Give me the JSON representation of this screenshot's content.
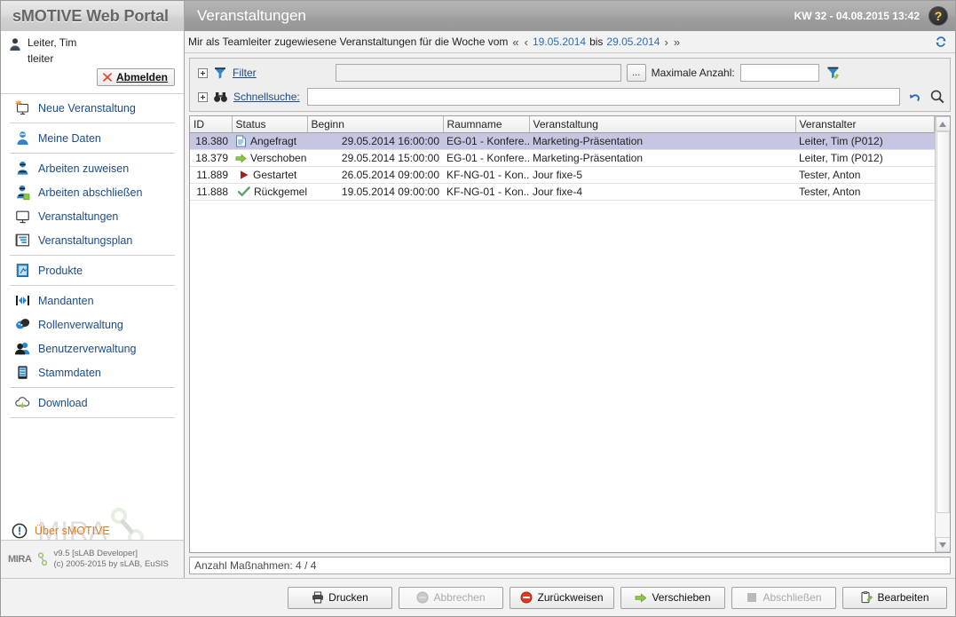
{
  "header": {
    "brand": "sMOTIVE Web Portal",
    "page_title": "Veranstaltungen",
    "datetime": "KW 32 - 04.08.2015 13:42",
    "help_label": "?",
    "help_icon": "question-mark-icon"
  },
  "sidebar": {
    "user": {
      "name": "Leiter, Tim",
      "login": "tleiter",
      "logout_label": "Abmelden",
      "logout_icon": "red-x-icon",
      "user_icon": "person-icon"
    },
    "groups": [
      {
        "items": [
          {
            "label": "Neue Veranstaltung",
            "icon": "new-presentation-icon"
          }
        ]
      },
      {
        "items": [
          {
            "label": "Meine Daten",
            "icon": "person-blue-icon"
          }
        ]
      },
      {
        "items": [
          {
            "label": "Arbeiten zuweisen",
            "icon": "assign-work-icon"
          },
          {
            "label": "Arbeiten abschließen",
            "icon": "complete-work-icon"
          },
          {
            "label": "Veranstaltungen",
            "icon": "monitor-icon"
          },
          {
            "label": "Veranstaltungsplan",
            "icon": "schedule-icon"
          }
        ]
      },
      {
        "items": [
          {
            "label": "Produkte",
            "icon": "product-book-icon"
          }
        ]
      },
      {
        "items": [
          {
            "label": "Mandanten",
            "icon": "clients-arrows-icon"
          },
          {
            "label": "Rollenverwaltung",
            "icon": "masks-roles-icon"
          },
          {
            "label": "Benutzerverwaltung",
            "icon": "users-icon"
          },
          {
            "label": "Stammdaten",
            "icon": "database-card-icon"
          }
        ]
      },
      {
        "items": [
          {
            "label": "Download",
            "icon": "cloud-download-icon"
          }
        ]
      }
    ],
    "watermark": "MIRA",
    "about": {
      "label": "Über sMOTIVE",
      "icon": "info-circle-icon"
    },
    "footer": {
      "logo": "MIRA",
      "line1": "v9.5 [sLAB Developer]",
      "line2": "(c) 2005-2015 by sLAB, EuSIS"
    }
  },
  "main": {
    "breadcrumb": {
      "prefix": "Mir als Teamleiter zugewiesene Veranstaltungen für die Woche vom",
      "first_icon": "double-chevron-left-icon",
      "prev_icon": "chevron-left-icon",
      "date_from": "19.05.2014",
      "between": "bis",
      "date_to": "29.05.2014",
      "next_icon": "chevron-right-icon",
      "last_icon": "double-chevron-right-icon",
      "refresh_icon": "refresh-icon"
    },
    "filter": {
      "filter_label": "Filter",
      "filter_icon": "funnel-icon",
      "filter_value": "",
      "filter_placeholder": "",
      "dots_label": "...",
      "max_count_label": "Maximale Anzahl:",
      "max_count_value": "",
      "apply_filter_icon": "funnel-apply-icon",
      "quicksearch_label": "Schnellsuche:",
      "quicksearch_icon": "binoculars-icon",
      "quicksearch_value": "",
      "reset_icon": "undo-arrow-icon",
      "search_icon": "magnifier-icon"
    },
    "table": {
      "columns": [
        "ID",
        "Status",
        "Beginn",
        "Raumname",
        "Veranstaltung",
        "Veranstalter"
      ],
      "rows": [
        {
          "id": "18.380",
          "status": "Angefragt",
          "status_icon": "document-requested-icon",
          "beginn": "29.05.2014 16:00:00",
          "raumname": "EG-01 - Konfere...",
          "veranstaltung": "Marketing-Präsentation",
          "veranstalter": "Leiter, Tim (P012)",
          "selected": true
        },
        {
          "id": "18.379",
          "status": "Verschoben",
          "status_icon": "green-arrow-right-icon",
          "beginn": "29.05.2014 15:00:00",
          "raumname": "EG-01 - Konfere...",
          "veranstaltung": "Marketing-Präsentation",
          "veranstalter": "Leiter, Tim (P012)",
          "selected": false
        },
        {
          "id": "11.889",
          "status": "Gestartet",
          "status_icon": "red-play-triangle-icon",
          "beginn": "26.05.2014 09:00:00",
          "raumname": "KF-NG-01 - Kon...",
          "veranstaltung": "Jour fixe-5",
          "veranstalter": "Tester, Anton",
          "selected": false
        },
        {
          "id": "11.888",
          "status": "Rückgemeld",
          "status_icon": "green-check-icon",
          "beginn": "19.05.2014 09:00:00",
          "raumname": "KF-NG-01 - Kon...",
          "veranstaltung": "Jour fixe-4",
          "veranstalter": "Tester, Anton",
          "selected": false
        }
      ],
      "scroll_up_icon": "scroll-up-arrow-icon",
      "scroll_down_icon": "scroll-down-arrow-icon"
    },
    "count_bar": "Anzahl Maßnahmen: 4 / 4"
  },
  "footer_buttons": [
    {
      "label": "Drucken",
      "icon": "printer-icon",
      "disabled": false
    },
    {
      "label": "Abbrechen",
      "icon": "cancel-circle-icon",
      "disabled": true
    },
    {
      "label": "Zurückweisen",
      "icon": "reject-red-icon",
      "disabled": false
    },
    {
      "label": "Verschieben",
      "icon": "move-green-arrow-icon",
      "disabled": false
    },
    {
      "label": "Abschließen",
      "icon": "finish-square-icon",
      "disabled": true
    },
    {
      "label": "Bearbeiten",
      "icon": "edit-pencil-icon",
      "disabled": false
    }
  ],
  "colors": {
    "link": "#1a4b8c",
    "accent_orange": "#e07b20",
    "selection": "#c5c7e2",
    "header_gray": "#9e9e9e"
  }
}
